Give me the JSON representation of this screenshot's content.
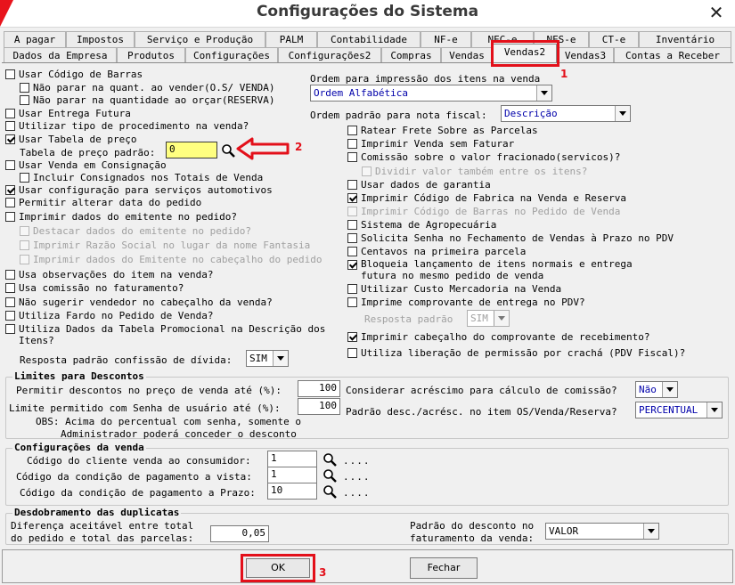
{
  "window": {
    "title": "Configurações do Sistema",
    "close_glyph": "✕"
  },
  "tabs_row1": [
    "A pagar",
    "Impostos",
    "Serviço e Produção",
    "PALM",
    "Contabilidade",
    "NF-e",
    "NFC-e",
    "NFS-e",
    "CT-e",
    "Inventário"
  ],
  "tabs_row2": [
    "Dados da Empresa",
    "Produtos",
    "Configurações",
    "Configurações2",
    "Compras",
    "Vendas",
    "Vendas2",
    "Vendas3",
    "Contas a Receber"
  ],
  "active_tab": "Vendas2",
  "left": {
    "usar_codigo_barras": "Usar Código de Barras",
    "nao_parar_venda": "Não parar na quant. ao vender(O.S/ VENDA)",
    "nao_parar_orcar": "Não parar na quantidade ao orçar(RESERVA)",
    "usar_entrega_futura": "Usar Entrega Futura",
    "utilizar_tipo_proc": "Utilizar tipo de procedimento na venda?",
    "usar_tabela_preco": "Usar Tabela de preço",
    "tabela_preco_padrao_label": "Tabela de preço padrão:",
    "tabela_preco_padrao_value": "0",
    "usar_venda_consignacao": "Usar Venda em Consignação",
    "incluir_consignados": "Incluir Consignados nos Totais de Venda",
    "usar_config_servicos": "Usar configuração para serviços automotivos",
    "permitir_alterar_data": "Permitir alterar data do pedido",
    "imprimir_dados_emitente": "Imprimir dados do emitente no pedido?",
    "destacar_dados": "Destacar dados do emitente no pedido?",
    "imprimir_razao": "Imprimir Razão Social no lugar da nome Fantasia",
    "imprimir_dados_cab": "Imprimir dados do Emitente no cabeçalho do pedido",
    "usa_observacoes": "Usa observações do item na venda?",
    "usa_comissao": "Usa comissão no faturamento?",
    "nao_sugerir_vendedor": "Não sugerir vendedor no cabeçalho da venda?",
    "utiliza_fardo": "Utiliza Fardo no Pedido de Venda?",
    "utiliza_dados_tabela_1": "Utiliza Dados da Tabela Promocional na Descrição dos",
    "utiliza_dados_tabela_2": "Itens?",
    "resposta_confissao_label": "Resposta padrão confissão de dívida:",
    "resposta_confissao_value": "SIM"
  },
  "right": {
    "ordem_impressao_label": "Ordem para impressão dos itens na venda",
    "ordem_impressao_value": "Ordem Alfabética",
    "ordem_nota_label": "Ordem padrão para nota fiscal:",
    "ordem_nota_value": "Descrição",
    "ratear_frete": "Ratear Frete Sobre as Parcelas",
    "imprimir_venda_sem_faturar": "Imprimir Venda sem Faturar",
    "comissao_fracionado": "Comissão sobre o valor fracionado(servicos)?",
    "dividir_valor": "Dividir valor também entre os itens?",
    "usar_dados_garantia": "Usar dados de garantia",
    "imprimir_codigo_fabrica": "Imprimir Código de Fabrica na Venda e Reserva",
    "imprimir_codigo_barras": "Imprimir Código de Barras no Pedido de Venda",
    "sistema_agropecuaria": "Sistema de Agropecuária",
    "solicita_senha": "Solicita Senha no Fechamento de Vendas à Prazo no PDV",
    "centavos_primeira": "Centavos na primeira parcela",
    "bloqueia_1": "Bloqueia lançamento de itens normais e entrega",
    "bloqueia_2": "futura no mesmo pedido de venda",
    "utilizar_custo": "Utilizar Custo Mercadoria  na Venda",
    "imprime_comprovante": "Imprime comprovante de entrega no PDV?",
    "resposta_padrao_label": "Resposta padrão",
    "resposta_padrao_value": "SIM",
    "imprimir_cabecalho": "Imprimir cabeçalho do comprovante de recebimento?",
    "utiliza_liberacao": "Utiliza liberação de permissão por crachá (PDV Fiscal)?"
  },
  "limites": {
    "title": "Limites para Descontos",
    "permitir_label": "Permitir descontos no preço de venda até (%):",
    "permitir_value": "100",
    "limite_label": "Limite permitido com Senha de usuário até (%):",
    "limite_value": "100",
    "obs_1": "OBS: Acima do percentual com senha, somente o",
    "obs_2": "Administrador poderá conceder o desconto",
    "considerar_label": "Considerar acréscimo para cálculo de comissão?",
    "considerar_value": "Não",
    "padrao_desc_label": "Padrão desc./acrésc. no item OS/Venda/Reserva?",
    "padrao_desc_value": "PERCENTUAL"
  },
  "config_venda": {
    "title": "Configurações da venda",
    "cliente_label": "Código do cliente venda ao consumidor:",
    "cliente_value": "1",
    "cond_vista_label": "Código da condição de pagamento a vista:",
    "cond_vista_value": "1",
    "cond_prazo_label": "Código da condição de pagamento a Prazo:",
    "cond_prazo_value": "10",
    "dots": "...."
  },
  "desdobramento": {
    "title": "Desdobramento das duplicatas",
    "diferenca_1": "Diferença aceitável entre total",
    "diferenca_2": "do pedido e total das parcelas:",
    "diferenca_value": "0,05",
    "padrao_desc_1": "Padrão do desconto no",
    "padrao_desc_2": "faturamento da venda:",
    "padrao_desc_value": "VALOR"
  },
  "buttons": {
    "ok": "OK",
    "fechar": "Fechar"
  },
  "annotations": {
    "n1": "1",
    "n2": "2",
    "n3": "3",
    "color": "#e3101a"
  }
}
